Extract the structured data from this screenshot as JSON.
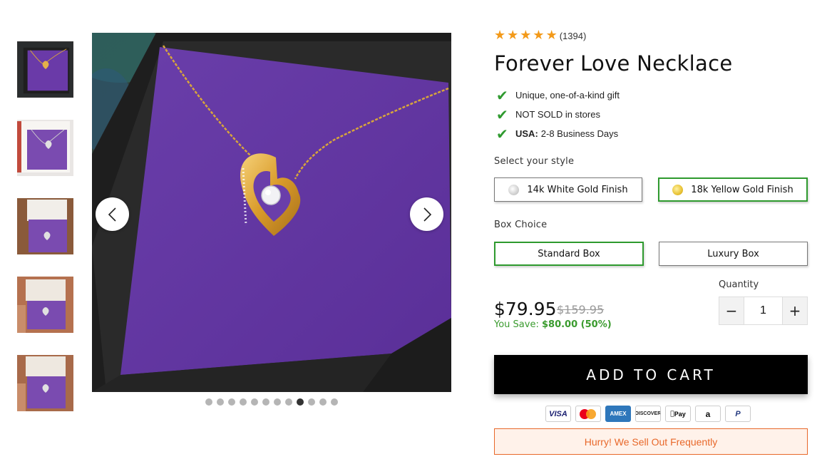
{
  "rating": {
    "stars": 5,
    "review_count": "(1394)"
  },
  "product": {
    "title": "Forever Love Necklace"
  },
  "bullets": [
    {
      "bold": "",
      "text": "Unique, one-of-a-kind gift"
    },
    {
      "bold": "",
      "text": "NOT SOLD in stores"
    },
    {
      "bold": "USA:",
      "text": "2-8 Business Days"
    }
  ],
  "style": {
    "label": "Select your style",
    "options": [
      {
        "label": "14k White Gold Finish",
        "selected": false
      },
      {
        "label": "18k Yellow Gold Finish",
        "selected": true
      }
    ]
  },
  "box": {
    "label": "Box Choice",
    "options": [
      {
        "label": "Standard Box",
        "selected": true
      },
      {
        "label": "Luxury Box",
        "selected": false
      }
    ]
  },
  "price": {
    "current": "$79.95",
    "original": "$159.95",
    "save_label": "You Save:",
    "save_amount": "$80.00 (50%)"
  },
  "quantity": {
    "label": "Quantity",
    "value": "1",
    "minus": "−",
    "plus": "+"
  },
  "cart": {
    "button_label": "ADD TO CART"
  },
  "payments": [
    "VISA",
    "mastercard",
    "AMEX",
    "DISCOVER",
    "Pay",
    "a",
    "P"
  ],
  "urgency": {
    "text": "Hurry! We Sell Out Frequently"
  },
  "gallery": {
    "thumbnail_count": 5,
    "dot_count": 12,
    "active_dot": 8
  },
  "colors": {
    "accent_green": "#2e9a2e",
    "star": "#f39a1a",
    "urgency": "#e8682a",
    "box_purple": "#6a3aa8"
  }
}
